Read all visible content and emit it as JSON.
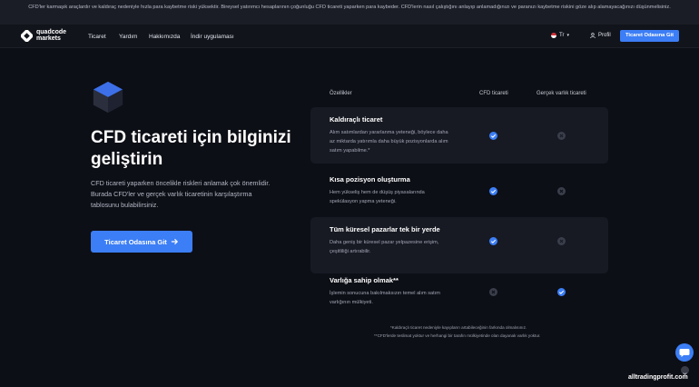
{
  "risk_banner": "CFD'ler karmaşık araçlardır ve kaldıraç nedeniyle hızla para kaybetme riski yüksektir. Bireysel yatırımcı hesaplarının çoğunluğu CFD ticareti yaparken para kaybeder. CFD'lerin nasıl çalıştığını anlayıp anlamadığınızı ve paranızı kaybetme riskini göze alıp alamayacağınızı düşünmelisiniz.",
  "header": {
    "logo_line1": "quadcode",
    "logo_line2": "markets",
    "nav": [
      "Ticaret",
      "Yardım",
      "Hakkımızda",
      "İndir uygulaması"
    ],
    "language": "Tr",
    "profile_label": "Profil",
    "cta_label": "Ticaret Odasına Git"
  },
  "hero": {
    "title": "CFD ticareti için bilginizi geliştirin",
    "description": "CFD ticareti yaparken öncelikle riskleri anlamak çok önemlidir. Burada CFD'ler ve gerçek varlık ticaretinin karşılaştırma tablosunu bulabilirsiniz.",
    "cta_label": "Ticaret Odasına Git"
  },
  "comparison": {
    "headers": [
      "Özellikler",
      "CFD ticareti",
      "Gerçek varlık ticareti"
    ],
    "rows": [
      {
        "title": "Kaldıraçlı ticaret",
        "description": "Alım satımlardan yararlanma yeteneği, böylece daha az miktarda yatırımla daha büyük pozisyonlarda alım satım yapabilme.*",
        "cfd": "check",
        "real": "cross"
      },
      {
        "title": "Kısa pozisyon oluşturma",
        "description": "Hem yükseliş hem de düşüş piyasalarında spekülasyon yapma yeteneği.",
        "cfd": "check",
        "real": "cross"
      },
      {
        "title": "Tüm küresel pazarlar tek bir yerde",
        "description": "Daha geniş bir küresel pazar yelpazesine erişim, çeşitliliği artırabilir.",
        "cfd": "check",
        "real": "cross"
      },
      {
        "title": "Varlığa sahip olmak**",
        "description": "İşlemin sonucuna bakılmaksızın temel alım satım varlığının mülkiyeti.",
        "cfd": "cross",
        "real": "check"
      }
    ]
  },
  "footnotes": [
    "*Kaldıraçlı ticaret nedeniyle kayıpların artabileceğinin farkında olmalısınız.",
    "**CFD'lerde teslimat yoktur ve herhangi bir tarafın mülkiyetinde olan dayanak varlık yoktur."
  ],
  "watermark": "alltradingprofit.com",
  "colors": {
    "accent": "#3c7ef5",
    "background": "#0d0f16",
    "row_shade": "#171a23"
  }
}
